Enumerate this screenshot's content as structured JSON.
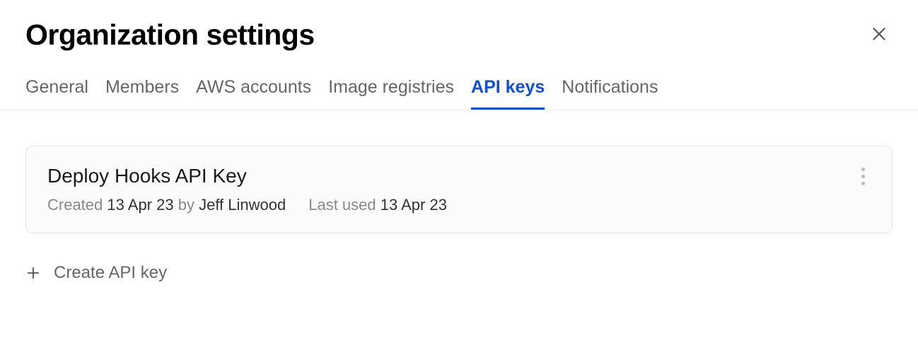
{
  "header": {
    "title": "Organization settings"
  },
  "tabs": [
    {
      "label": "General",
      "active": false
    },
    {
      "label": "Members",
      "active": false
    },
    {
      "label": "AWS accounts",
      "active": false
    },
    {
      "label": "Image registries",
      "active": false
    },
    {
      "label": "API keys",
      "active": true
    },
    {
      "label": "Notifications",
      "active": false
    }
  ],
  "api_keys": [
    {
      "name": "Deploy Hooks API Key",
      "created_label": "Created",
      "created_date": "13 Apr 23",
      "created_by_label": "by",
      "created_by": "Jeff Linwood",
      "last_used_label": "Last used",
      "last_used_date": "13 Apr 23"
    }
  ],
  "actions": {
    "create_label": "Create API key"
  }
}
